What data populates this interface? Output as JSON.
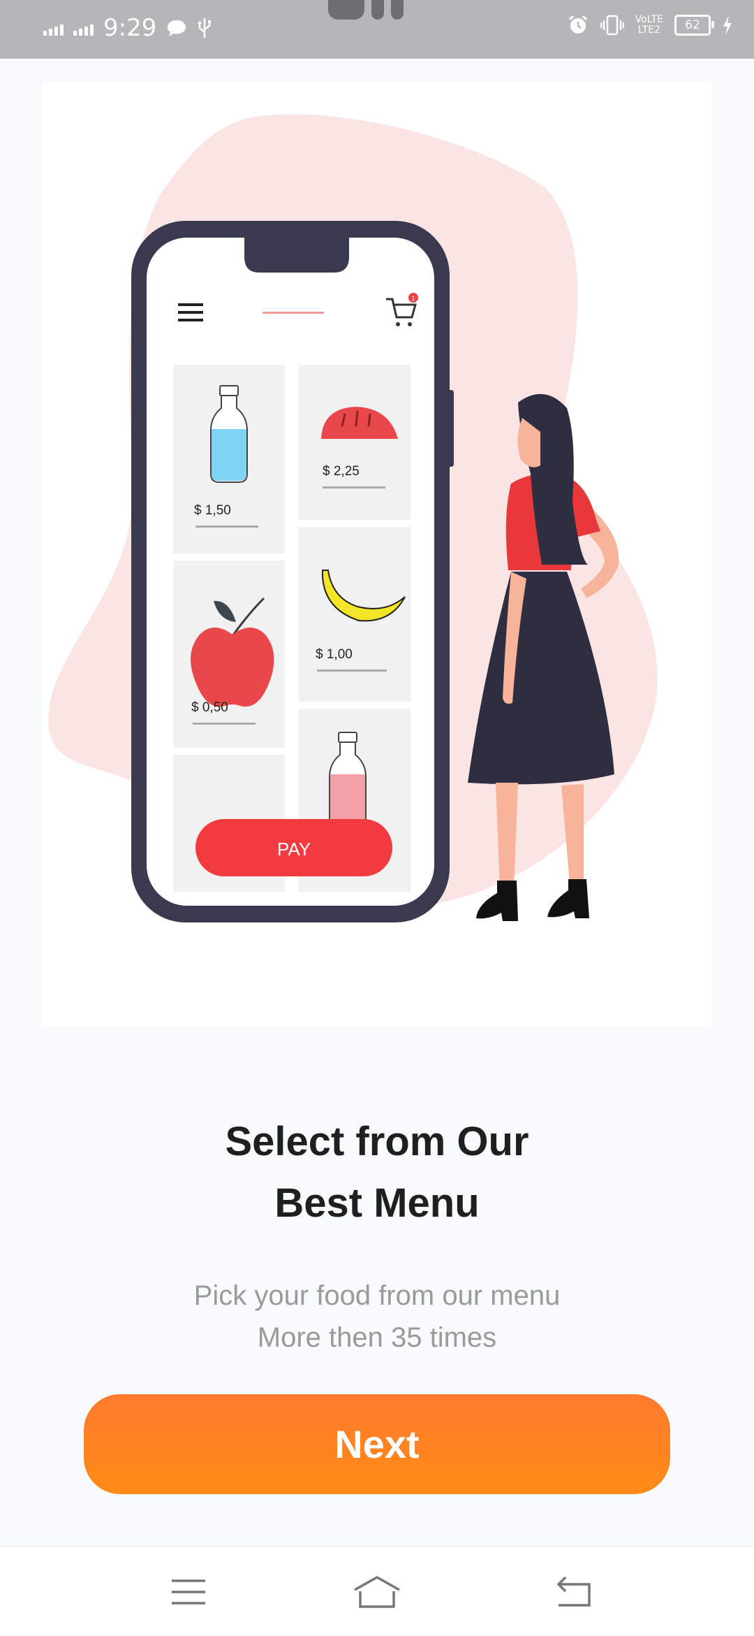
{
  "status_bar": {
    "time": "9:29",
    "network_label_top": "VoLTE",
    "network_label_bottom": "LTE2",
    "battery": "62",
    "icons": [
      "signal-icon",
      "signal-icon",
      "chat-bubble-icon",
      "usb-icon",
      "alarm-icon",
      "vibrate-icon",
      "volte-icon",
      "battery-icon",
      "charging-icon"
    ]
  },
  "illustration": {
    "products": [
      {
        "name": "water bottle",
        "price": "$ 1,50"
      },
      {
        "name": "bread",
        "price": "$ 2,25"
      },
      {
        "name": "apple",
        "price": "$ 0,50"
      },
      {
        "name": "banana",
        "price": "$ 1,00"
      }
    ],
    "pay_label": "PAY",
    "cart_badge": "1"
  },
  "onboarding": {
    "title_line1": "Select from Our",
    "title_line2": "Best Menu",
    "subtitle_line1": "Pick your food from our menu",
    "subtitle_line2": "More then 35 times",
    "next_label": "Next"
  },
  "nav_bar": {
    "icons": [
      "menu-icon",
      "home-icon",
      "back-icon"
    ]
  },
  "colors": {
    "accent": "#ff8a1e",
    "pay_red": "#f23b3e",
    "phone_frame": "#3a3a4f",
    "blob_pink": "#fbe4e4"
  }
}
